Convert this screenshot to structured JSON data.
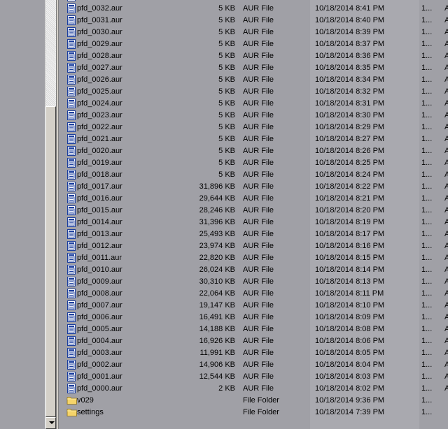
{
  "colors": {
    "background": "#a0a0a6",
    "sorted_column": "#a9a9af",
    "folder_yellow": "#f5d46a",
    "file_icon_blue": "#1c3f9e"
  },
  "icons": {
    "file": "document-file-icon",
    "folder": "folder-icon"
  },
  "files": [
    {
      "name": "pfd_0032.aur",
      "size": "5 KB",
      "type": "AUR File",
      "modified": "10/18/2014 8:41 PM",
      "col5": "1...",
      "col6": "A",
      "kind": "file"
    },
    {
      "name": "pfd_0031.aur",
      "size": "5 KB",
      "type": "AUR File",
      "modified": "10/18/2014 8:40 PM",
      "col5": "1...",
      "col6": "A",
      "kind": "file"
    },
    {
      "name": "pfd_0030.aur",
      "size": "5 KB",
      "type": "AUR File",
      "modified": "10/18/2014 8:39 PM",
      "col5": "1...",
      "col6": "A",
      "kind": "file"
    },
    {
      "name": "pfd_0029.aur",
      "size": "5 KB",
      "type": "AUR File",
      "modified": "10/18/2014 8:37 PM",
      "col5": "1...",
      "col6": "A",
      "kind": "file"
    },
    {
      "name": "pfd_0028.aur",
      "size": "5 KB",
      "type": "AUR File",
      "modified": "10/18/2014 8:36 PM",
      "col5": "1...",
      "col6": "A",
      "kind": "file"
    },
    {
      "name": "pfd_0027.aur",
      "size": "5 KB",
      "type": "AUR File",
      "modified": "10/18/2014 8:35 PM",
      "col5": "1...",
      "col6": "A",
      "kind": "file"
    },
    {
      "name": "pfd_0026.aur",
      "size": "5 KB",
      "type": "AUR File",
      "modified": "10/18/2014 8:34 PM",
      "col5": "1...",
      "col6": "A",
      "kind": "file"
    },
    {
      "name": "pfd_0025.aur",
      "size": "5 KB",
      "type": "AUR File",
      "modified": "10/18/2014 8:32 PM",
      "col5": "1...",
      "col6": "A",
      "kind": "file"
    },
    {
      "name": "pfd_0024.aur",
      "size": "5 KB",
      "type": "AUR File",
      "modified": "10/18/2014 8:31 PM",
      "col5": "1...",
      "col6": "A",
      "kind": "file"
    },
    {
      "name": "pfd_0023.aur",
      "size": "5 KB",
      "type": "AUR File",
      "modified": "10/18/2014 8:30 PM",
      "col5": "1...",
      "col6": "A",
      "kind": "file"
    },
    {
      "name": "pfd_0022.aur",
      "size": "5 KB",
      "type": "AUR File",
      "modified": "10/18/2014 8:29 PM",
      "col5": "1...",
      "col6": "A",
      "kind": "file"
    },
    {
      "name": "pfd_0021.aur",
      "size": "5 KB",
      "type": "AUR File",
      "modified": "10/18/2014 8:27 PM",
      "col5": "1...",
      "col6": "A",
      "kind": "file"
    },
    {
      "name": "pfd_0020.aur",
      "size": "5 KB",
      "type": "AUR File",
      "modified": "10/18/2014 8:26 PM",
      "col5": "1...",
      "col6": "A",
      "kind": "file"
    },
    {
      "name": "pfd_0019.aur",
      "size": "5 KB",
      "type": "AUR File",
      "modified": "10/18/2014 8:25 PM",
      "col5": "1...",
      "col6": "A",
      "kind": "file"
    },
    {
      "name": "pfd_0018.aur",
      "size": "5 KB",
      "type": "AUR File",
      "modified": "10/18/2014 8:24 PM",
      "col5": "1...",
      "col6": "A",
      "kind": "file"
    },
    {
      "name": "pfd_0017.aur",
      "size": "31,896 KB",
      "type": "AUR File",
      "modified": "10/18/2014 8:22 PM",
      "col5": "1...",
      "col6": "A",
      "kind": "file"
    },
    {
      "name": "pfd_0016.aur",
      "size": "29,644 KB",
      "type": "AUR File",
      "modified": "10/18/2014 8:21 PM",
      "col5": "1...",
      "col6": "A",
      "kind": "file"
    },
    {
      "name": "pfd_0015.aur",
      "size": "28,246 KB",
      "type": "AUR File",
      "modified": "10/18/2014 8:20 PM",
      "col5": "1...",
      "col6": "A",
      "kind": "file"
    },
    {
      "name": "pfd_0014.aur",
      "size": "31,396 KB",
      "type": "AUR File",
      "modified": "10/18/2014 8:19 PM",
      "col5": "1...",
      "col6": "A",
      "kind": "file"
    },
    {
      "name": "pfd_0013.aur",
      "size": "25,493 KB",
      "type": "AUR File",
      "modified": "10/18/2014 8:17 PM",
      "col5": "1...",
      "col6": "A",
      "kind": "file"
    },
    {
      "name": "pfd_0012.aur",
      "size": "23,974 KB",
      "type": "AUR File",
      "modified": "10/18/2014 8:16 PM",
      "col5": "1...",
      "col6": "A",
      "kind": "file"
    },
    {
      "name": "pfd_0011.aur",
      "size": "22,820 KB",
      "type": "AUR File",
      "modified": "10/18/2014 8:15 PM",
      "col5": "1...",
      "col6": "A",
      "kind": "file"
    },
    {
      "name": "pfd_0010.aur",
      "size": "26,024 KB",
      "type": "AUR File",
      "modified": "10/18/2014 8:14 PM",
      "col5": "1...",
      "col6": "A",
      "kind": "file"
    },
    {
      "name": "pfd_0009.aur",
      "size": "30,310 KB",
      "type": "AUR File",
      "modified": "10/18/2014 8:13 PM",
      "col5": "1...",
      "col6": "A",
      "kind": "file"
    },
    {
      "name": "pfd_0008.aur",
      "size": "22,064 KB",
      "type": "AUR File",
      "modified": "10/18/2014 8:11 PM",
      "col5": "1...",
      "col6": "A",
      "kind": "file"
    },
    {
      "name": "pfd_0007.aur",
      "size": "19,147 KB",
      "type": "AUR File",
      "modified": "10/18/2014 8:10 PM",
      "col5": "1...",
      "col6": "A",
      "kind": "file"
    },
    {
      "name": "pfd_0006.aur",
      "size": "16,491 KB",
      "type": "AUR File",
      "modified": "10/18/2014 8:09 PM",
      "col5": "1...",
      "col6": "A",
      "kind": "file"
    },
    {
      "name": "pfd_0005.aur",
      "size": "14,188 KB",
      "type": "AUR File",
      "modified": "10/18/2014 8:08 PM",
      "col5": "1...",
      "col6": "A",
      "kind": "file"
    },
    {
      "name": "pfd_0004.aur",
      "size": "16,926 KB",
      "type": "AUR File",
      "modified": "10/18/2014 8:06 PM",
      "col5": "1...",
      "col6": "A",
      "kind": "file"
    },
    {
      "name": "pfd_0003.aur",
      "size": "11,991 KB",
      "type": "AUR File",
      "modified": "10/18/2014 8:05 PM",
      "col5": "1...",
      "col6": "A",
      "kind": "file"
    },
    {
      "name": "pfd_0002.aur",
      "size": "14,906 KB",
      "type": "AUR File",
      "modified": "10/18/2014 8:04 PM",
      "col5": "1...",
      "col6": "A",
      "kind": "file"
    },
    {
      "name": "pfd_0001.aur",
      "size": "12,544 KB",
      "type": "AUR File",
      "modified": "10/18/2014 8:03 PM",
      "col5": "1...",
      "col6": "A",
      "kind": "file"
    },
    {
      "name": "pfd_0000.aur",
      "size": "2 KB",
      "type": "AUR File",
      "modified": "10/18/2014 8:02 PM",
      "col5": "1...",
      "col6": "A",
      "kind": "file"
    },
    {
      "name": "v029",
      "size": "",
      "type": "File Folder",
      "modified": "10/18/2014 9:36 PM",
      "col5": "1...",
      "col6": "",
      "kind": "folder"
    },
    {
      "name": "settings",
      "size": "",
      "type": "File Folder",
      "modified": "10/18/2014 7:39 PM",
      "col5": "1...",
      "col6": "",
      "kind": "folder"
    }
  ]
}
